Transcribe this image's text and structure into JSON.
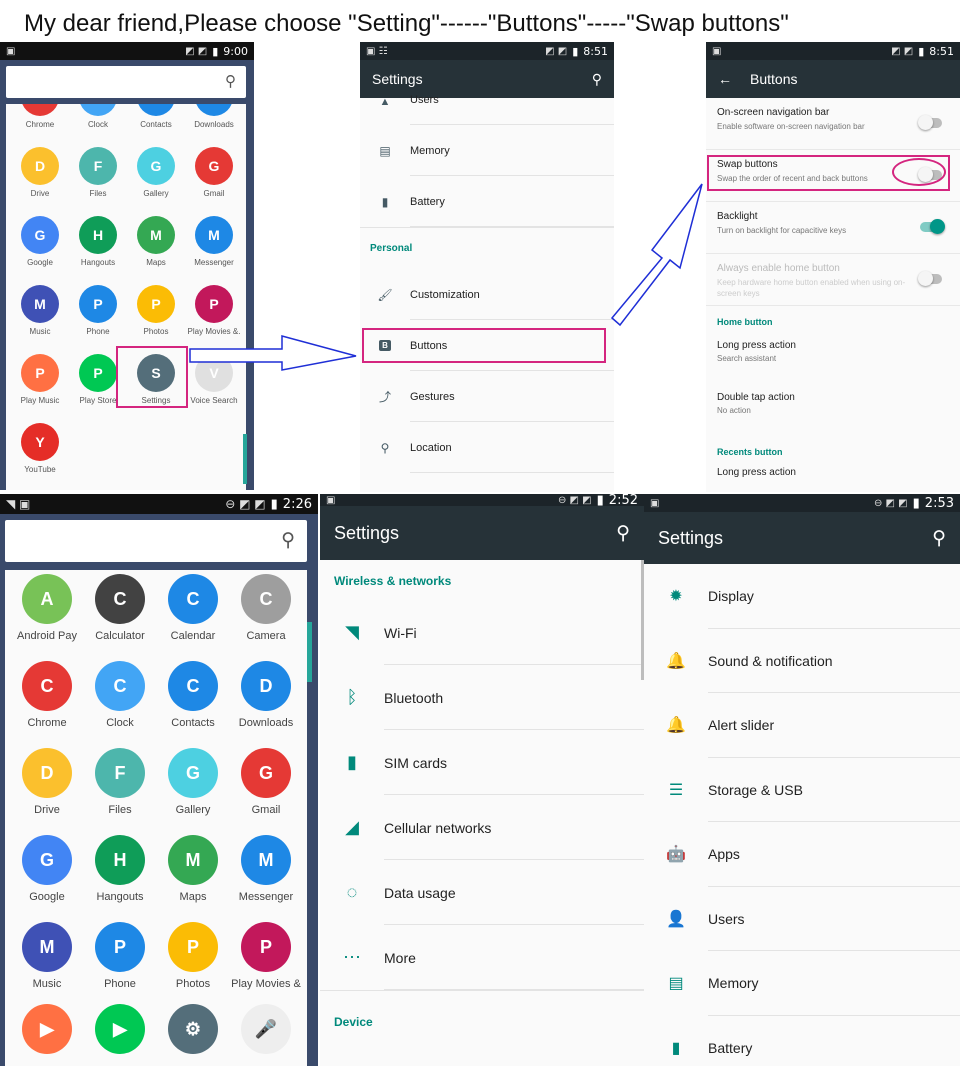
{
  "heading": "My dear friend,Please choose \"Setting\"------\"Buttons\"-----\"Swap buttons\"",
  "p1": {
    "time": "9:00",
    "apps": [
      {
        "label": "Chrome",
        "color": "#e53935"
      },
      {
        "label": "Clock",
        "color": "#42a5f5"
      },
      {
        "label": "Contacts",
        "color": "#1e88e5"
      },
      {
        "label": "Downloads",
        "color": "#1e88e5"
      },
      {
        "label": "Drive",
        "color": "#fbc02d"
      },
      {
        "label": "Files",
        "color": "#4db6ac"
      },
      {
        "label": "Gallery",
        "color": "#4dd0e1"
      },
      {
        "label": "Gmail",
        "color": "#e53935"
      },
      {
        "label": "Google",
        "color": "#4285f4"
      },
      {
        "label": "Hangouts",
        "color": "#0f9d58"
      },
      {
        "label": "Maps",
        "color": "#34a853"
      },
      {
        "label": "Messenger",
        "color": "#1e88e5"
      },
      {
        "label": "Music",
        "color": "#3f51b5"
      },
      {
        "label": "Phone",
        "color": "#1e88e5"
      },
      {
        "label": "Photos",
        "color": "#fbbc05"
      },
      {
        "label": "Play Movies &.",
        "color": "#c2185b"
      },
      {
        "label": "Play Music",
        "color": "#ff7043"
      },
      {
        "label": "Play Store",
        "color": "#00c853"
      },
      {
        "label": "Settings",
        "color": "#546e7a"
      },
      {
        "label": "Voice Search",
        "color": "#e0e0e0"
      },
      {
        "label": "YouTube",
        "color": "#e52d27"
      }
    ]
  },
  "p2": {
    "time": "8:51",
    "title": "Settings",
    "partial_top": "Users",
    "rows": [
      {
        "label": "Memory",
        "icon": "▤"
      },
      {
        "label": "Battery",
        "icon": "▮"
      }
    ],
    "section": "Personal",
    "rows2": [
      {
        "label": "Customization",
        "icon": "🖌"
      },
      {
        "label": "Buttons",
        "icon": "B"
      },
      {
        "label": "Gestures",
        "icon": "⤴"
      },
      {
        "label": "Location",
        "icon": "⚲"
      }
    ]
  },
  "p3": {
    "time": "8:51",
    "title": "Buttons",
    "items": [
      {
        "title": "On-screen navigation bar",
        "sub": "Enable software on-screen navigation bar",
        "state": "off"
      },
      {
        "title": "Swap buttons",
        "sub": "Swap the order of recent and back buttons",
        "state": "off"
      },
      {
        "title": "Backlight",
        "sub": "Turn on backlight for capacitive keys",
        "state": "on"
      },
      {
        "title": "Always enable home button",
        "sub": "Keep hardware home button enabled when using on-screen keys",
        "state": "disabled"
      }
    ],
    "home_section": "Home button",
    "home_items": [
      {
        "title": "Long press action",
        "sub": "Search assistant"
      },
      {
        "title": "Double tap action",
        "sub": "No action"
      }
    ],
    "recents_section": "Recents button",
    "recents_item": "Long press action"
  },
  "p4": {
    "time": "2:26",
    "apps": [
      {
        "label": "Android Pay",
        "color": "#78c257"
      },
      {
        "label": "Calculator",
        "color": "#424242"
      },
      {
        "label": "Calendar",
        "color": "#1e88e5"
      },
      {
        "label": "Camera",
        "color": "#9e9e9e"
      },
      {
        "label": "Chrome",
        "color": "#e53935"
      },
      {
        "label": "Clock",
        "color": "#42a5f5"
      },
      {
        "label": "Contacts",
        "color": "#1e88e5"
      },
      {
        "label": "Downloads",
        "color": "#1e88e5"
      },
      {
        "label": "Drive",
        "color": "#fbc02d"
      },
      {
        "label": "Files",
        "color": "#4db6ac"
      },
      {
        "label": "Gallery",
        "color": "#4dd0e1"
      },
      {
        "label": "Gmail",
        "color": "#e53935"
      },
      {
        "label": "Google",
        "color": "#4285f4"
      },
      {
        "label": "Hangouts",
        "color": "#0f9d58"
      },
      {
        "label": "Maps",
        "color": "#34a853"
      },
      {
        "label": "Messenger",
        "color": "#1e88e5"
      },
      {
        "label": "Music",
        "color": "#3f51b5"
      },
      {
        "label": "Phone",
        "color": "#1e88e5"
      },
      {
        "label": "Photos",
        "color": "#fbbc05"
      },
      {
        "label": "Play Movies &",
        "color": "#c2185b"
      }
    ]
  },
  "p5": {
    "time": "2:52",
    "title": "Settings",
    "section": "Wireless & networks",
    "rows": [
      {
        "label": "Wi-Fi",
        "icon": "◥"
      },
      {
        "label": "Bluetooth",
        "icon": "ᛒ"
      },
      {
        "label": "SIM cards",
        "icon": "▮"
      },
      {
        "label": "Cellular networks",
        "icon": "◢"
      },
      {
        "label": "Data usage",
        "icon": "◌"
      },
      {
        "label": "More",
        "icon": "⋯"
      }
    ],
    "section2": "Device"
  },
  "p6": {
    "time": "2:53",
    "title": "Settings",
    "rows": [
      {
        "label": "Display",
        "icon": "✹"
      },
      {
        "label": "Sound & notification",
        "icon": "🔔"
      },
      {
        "label": "Alert slider",
        "icon": "🔔"
      },
      {
        "label": "Storage & USB",
        "icon": "☰"
      },
      {
        "label": "Apps",
        "icon": "🤖"
      },
      {
        "label": "Users",
        "icon": "👤"
      },
      {
        "label": "Memory",
        "icon": "▤"
      },
      {
        "label": "Battery",
        "icon": "▮"
      }
    ]
  },
  "colors": {
    "accent": "#00897b",
    "toolbar": "#263238",
    "highlight": "#d4257f",
    "arrow": "#1f2fd6"
  }
}
